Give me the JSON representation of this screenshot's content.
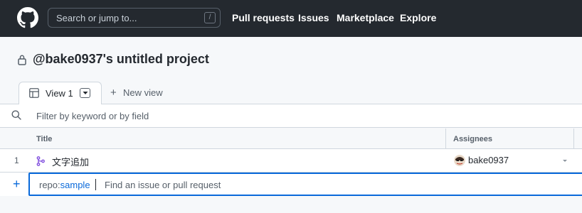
{
  "header": {
    "search_placeholder": "Search or jump to...",
    "search_shortcut": "/",
    "nav": [
      "Pull requests",
      "Issues",
      "Marketplace",
      "Explore"
    ]
  },
  "project": {
    "title": "@bake0937's untitled project"
  },
  "tabs": {
    "active": "View 1",
    "new_view": "New view"
  },
  "filter": {
    "placeholder": "Filter by keyword or by field"
  },
  "table": {
    "columns": [
      "Title",
      "Assignees"
    ],
    "rows": [
      {
        "num": "1",
        "title": "文字追加",
        "assignee": "bake0937"
      }
    ],
    "add_row": {
      "prefix_key": "repo:",
      "prefix_value": "sample",
      "placeholder": "Find an issue or pull request"
    }
  },
  "colors": {
    "header_bg": "#24292f",
    "accent": "#0969da",
    "pr_icon": "#8250df"
  }
}
